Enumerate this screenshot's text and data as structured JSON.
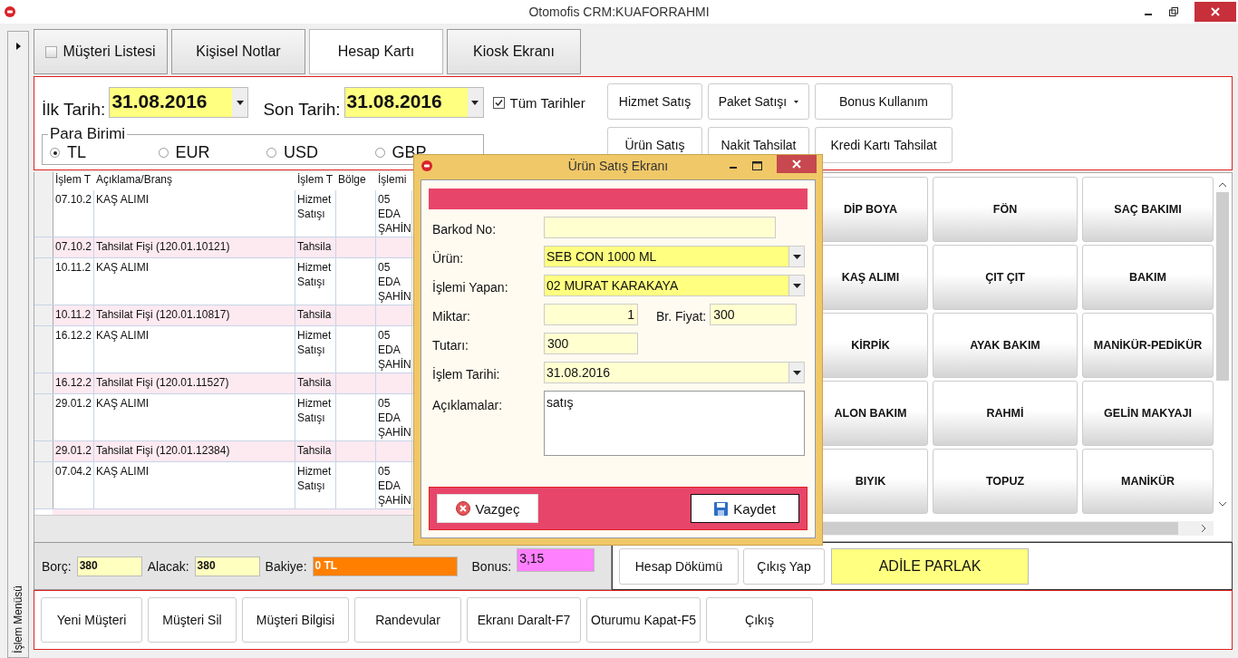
{
  "window": {
    "title": "Otomofis CRM:KUAFORRAHMI"
  },
  "side_menu": {
    "label": "İşlem Menüsü"
  },
  "tabs": [
    {
      "label": "Müşteri Listesi",
      "selected": false,
      "kind": "checkbox",
      "checked": false
    },
    {
      "label": "Kişisel Notlar",
      "selected": false,
      "kind": "plain"
    },
    {
      "label": "Hesap Kartı",
      "selected": true,
      "kind": "plain"
    },
    {
      "label": "Kiosk Ekranı",
      "selected": false,
      "kind": "plain"
    }
  ],
  "filters": {
    "start_label": "İlk Tarih:",
    "start_value": "31.08.2016",
    "end_label": "Son Tarih:",
    "end_value": "31.08.2016",
    "all_dates": {
      "label": "Tüm Tarihler",
      "checked": true
    }
  },
  "currency": {
    "legend": "Para Birimi",
    "options": [
      {
        "label": "TL",
        "selected": true
      },
      {
        "label": "EUR",
        "selected": false
      },
      {
        "label": "USD",
        "selected": false
      },
      {
        "label": "GBP",
        "selected": false
      }
    ]
  },
  "actions": [
    {
      "label": "Hizmet Satış",
      "kind": "button"
    },
    {
      "label": "Paket Satışı",
      "kind": "dropdown"
    },
    {
      "label": "Bonus Kullanım",
      "kind": "button"
    },
    {
      "label": "Ürün Satış",
      "kind": "button"
    },
    {
      "label": "Nakit Tahsilat",
      "kind": "button"
    },
    {
      "label": "Kredi Kartı Tahsilat",
      "kind": "button"
    }
  ],
  "table": {
    "columns": [
      "İşlem T",
      "Açıklama/Branş",
      "İşlem T",
      "Bölge",
      "İşlemi"
    ],
    "rows": [
      {
        "kind": "service",
        "cells": [
          "07.10.2",
          "KAŞ ALIMI",
          "Hizmet Satışı",
          "",
          "05 EDA ŞAHİN"
        ]
      },
      {
        "kind": "payment",
        "cells": [
          "07.10.2",
          "Tahsilat Fişi (120.01.10121)",
          "Tahsila",
          "",
          ""
        ]
      },
      {
        "kind": "service",
        "cells": [
          "10.11.2",
          "KAŞ ALIMI",
          "Hizmet Satışı",
          "",
          "05 EDA ŞAHİN"
        ]
      },
      {
        "kind": "payment",
        "cells": [
          "10.11.2",
          "Tahsilat Fişi (120.01.10817)",
          "Tahsila",
          "",
          ""
        ]
      },
      {
        "kind": "service",
        "cells": [
          "16.12.2",
          "KAŞ ALIMI",
          "Hizmet Satışı",
          "",
          "05 EDA ŞAHİN"
        ]
      },
      {
        "kind": "payment",
        "cells": [
          "16.12.2",
          "Tahsilat Fişi (120.01.11527)",
          "Tahsila",
          "",
          ""
        ]
      },
      {
        "kind": "service",
        "cells": [
          "29.01.2",
          "KAŞ ALIMI",
          "Hizmet Satışı",
          "",
          "05 EDA ŞAHİN"
        ]
      },
      {
        "kind": "payment",
        "cells": [
          "29.01.2",
          "Tahsilat Fişi (120.01.12384)",
          "Tahsila",
          "",
          ""
        ]
      },
      {
        "kind": "service",
        "cells": [
          "07.04.2",
          "KAŞ ALIMI",
          "Hizmet Satışı",
          "",
          "05 EDA ŞAHİN"
        ]
      }
    ]
  },
  "services": [
    "DİP BOYA",
    "FÖN",
    "SAÇ BAKIMI",
    "KAŞ ALIMI",
    "ÇIT ÇIT",
    "BAKIM",
    "KİRPİK",
    "AYAK BAKIM",
    "MANİKÜR-PEDİKÜR",
    "ALON BAKIM",
    "RAHMİ",
    "GELİN MAKYAJI",
    "BIYIK",
    "TOPUZ",
    "MANİKÜR"
  ],
  "dialog": {
    "title": "Ürün Satış Ekranı",
    "rows": [
      {
        "label": "Barkod No:",
        "kind": "text"
      },
      {
        "label": "Ürün:",
        "kind": "combo",
        "value": "SEB CON 1000 ML"
      },
      {
        "label": "İşlemi Yapan:",
        "kind": "combo",
        "value": "02 MURAT KARAKAYA"
      },
      {
        "label": "Miktar:",
        "kind": "number",
        "value": "1",
        "extra": {
          "label": "Br. Fiyat:",
          "value": "300"
        }
      },
      {
        "label": "Tutarı:",
        "kind": "short",
        "value": "300"
      },
      {
        "label": "İşlem Tarihi:",
        "kind": "date",
        "value": "31.08.2016"
      },
      {
        "label": "Açıklamalar:",
        "kind": "textarea",
        "value": "satış"
      }
    ],
    "cancel": "Vazgeç",
    "save": "Kaydet"
  },
  "summary": {
    "debt_label": "Borç:",
    "debt": "380",
    "credit_label": "Alacak:",
    "credit": "380",
    "balance_label": "Bakiye:",
    "balance": "0 TL",
    "bonus_label": "Bonus:",
    "bonus": "3,15"
  },
  "account_buttons": [
    "Hesap Dökümü",
    "Çıkış Yap"
  ],
  "customer": "ADİLE PARLAK",
  "bottom_buttons": [
    "Yeni Müşteri",
    "Müşteri Sil",
    "Müşteri Bilgisi",
    "Randevular",
    "Ekranı Daralt-F7",
    "Oturumu Kapat-F5",
    "Çıkış"
  ]
}
